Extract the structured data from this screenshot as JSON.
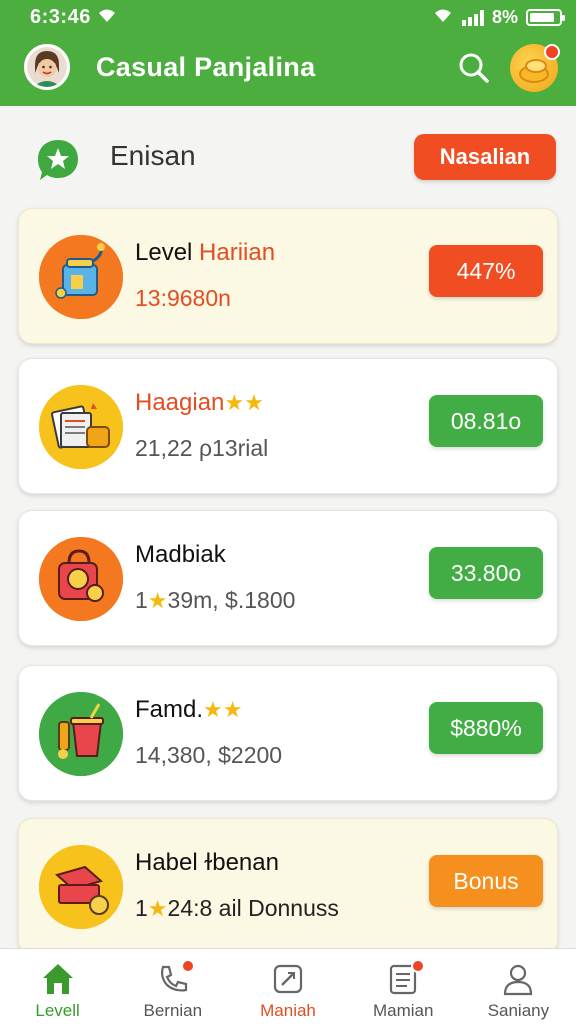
{
  "status_bar": {
    "time": "6:3:46",
    "battery": "8%",
    "battery_level": 0.85
  },
  "header": {
    "title": "Casual Panjalina"
  },
  "section": {
    "title": "Enisan",
    "button_label": "Nasalian"
  },
  "cards": [
    {
      "title_prefix": "Level ",
      "title_accent": "Hariian",
      "subtitle": "13:9680n",
      "button_label": "447%",
      "button_color": "red",
      "icon": "paint-bucket-icon",
      "icon_bg": "#f4781f"
    },
    {
      "title": "Haagian",
      "stars": "★★",
      "subtitle": "21,22 ρ13rial",
      "button_label": "08.81o",
      "button_color": "green",
      "icon": "documents-icon",
      "icon_bg": "#f8c21d"
    },
    {
      "title": "Madbiak",
      "subtitle_prefix": "1",
      "subtitle_star": "★",
      "subtitle": "39m, $.1800",
      "button_label": "33.80o",
      "button_color": "green",
      "icon": "gift-bag-icon",
      "icon_bg": "#f4781f"
    },
    {
      "title": "Famd.",
      "stars": "★★",
      "subtitle": "14,380, $2200",
      "button_label": "$880%",
      "button_color": "green",
      "icon": "drink-cup-icon",
      "icon_bg": "#3ea945"
    },
    {
      "title": "Habel ɫbenan",
      "subtitle_prefix": "1",
      "subtitle_star": "★",
      "subtitle": "24:8 ail Donnuss",
      "button_label": "Bonus",
      "button_color": "orange",
      "icon": "gold-bars-icon",
      "icon_bg": "#f8c21d"
    }
  ],
  "bottom_nav": [
    {
      "label": "Levell",
      "icon": "home-icon"
    },
    {
      "label": "Bernian",
      "icon": "phone-icon"
    },
    {
      "label": "Maniah",
      "icon": "edit-icon"
    },
    {
      "label": "Mamian",
      "icon": "list-icon"
    },
    {
      "label": "Saniany",
      "icon": "profile-icon"
    }
  ]
}
